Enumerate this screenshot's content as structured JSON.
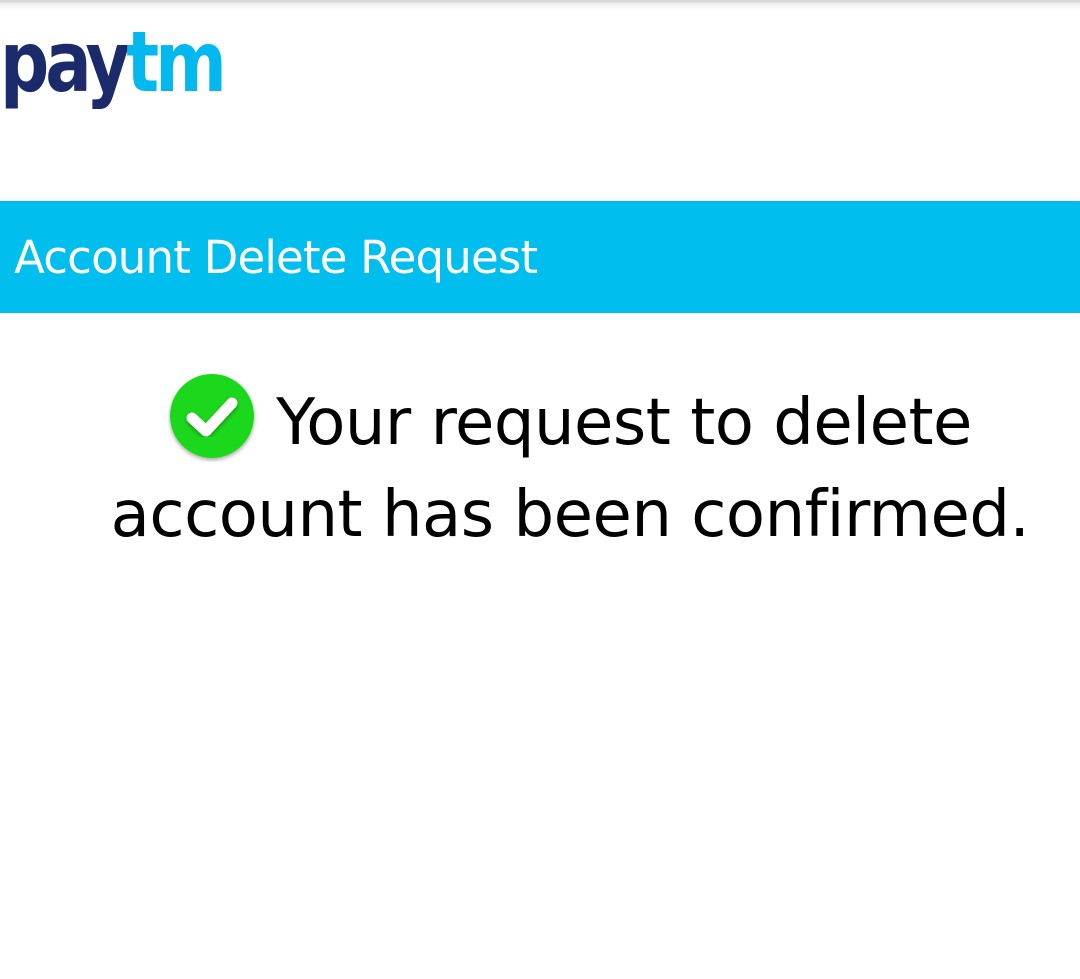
{
  "brand": {
    "logo_text_part1": "pay",
    "logo_text_part2": "tm",
    "colors": {
      "logo_dark": "#1b2a6b",
      "logo_light": "#02b8ef",
      "title_bar": "#00bfef",
      "success_green": "#1ed81e"
    }
  },
  "header": {
    "title": "Account Delete Request"
  },
  "main": {
    "status_icon": "check-circle-icon",
    "message_line1": "Your request to delete",
    "message_line2": "account has been confirmed."
  }
}
